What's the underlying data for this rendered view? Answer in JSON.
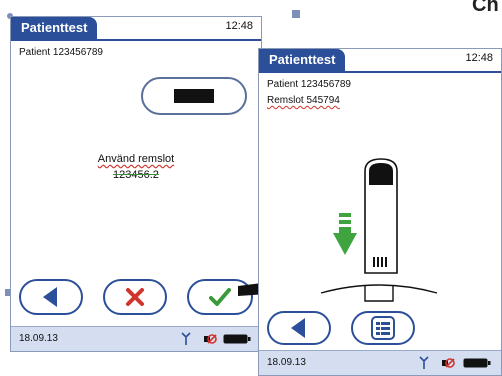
{
  "screen1": {
    "title": "Patienttest",
    "time": "12:48",
    "patient_line": "Patient  123456789",
    "prompt_line1": "Använd remslot",
    "prompt_line2": "123456.2",
    "date": "18.09.13"
  },
  "screen2": {
    "title": "Patienttest",
    "time": "12:48",
    "patient_line": "Patient  123456789",
    "lot_line": "Remslot  545794",
    "date": "18.09.13"
  },
  "corner_label": "Ch",
  "colors": {
    "title_blue": "#2b4f99",
    "status_bg": "#d4def0",
    "cancel_red": "#d0342c",
    "ok_green": "#3a9a3a",
    "arrow_green": "#3fa33f"
  },
  "icons": [
    "back-arrow-icon",
    "cancel-x-icon",
    "confirm-check-icon",
    "list-menu-icon",
    "antenna-icon",
    "no-sound-icon",
    "battery-icon",
    "test-strip-icon",
    "down-arrow-icon",
    "arrow-right-icon"
  ]
}
